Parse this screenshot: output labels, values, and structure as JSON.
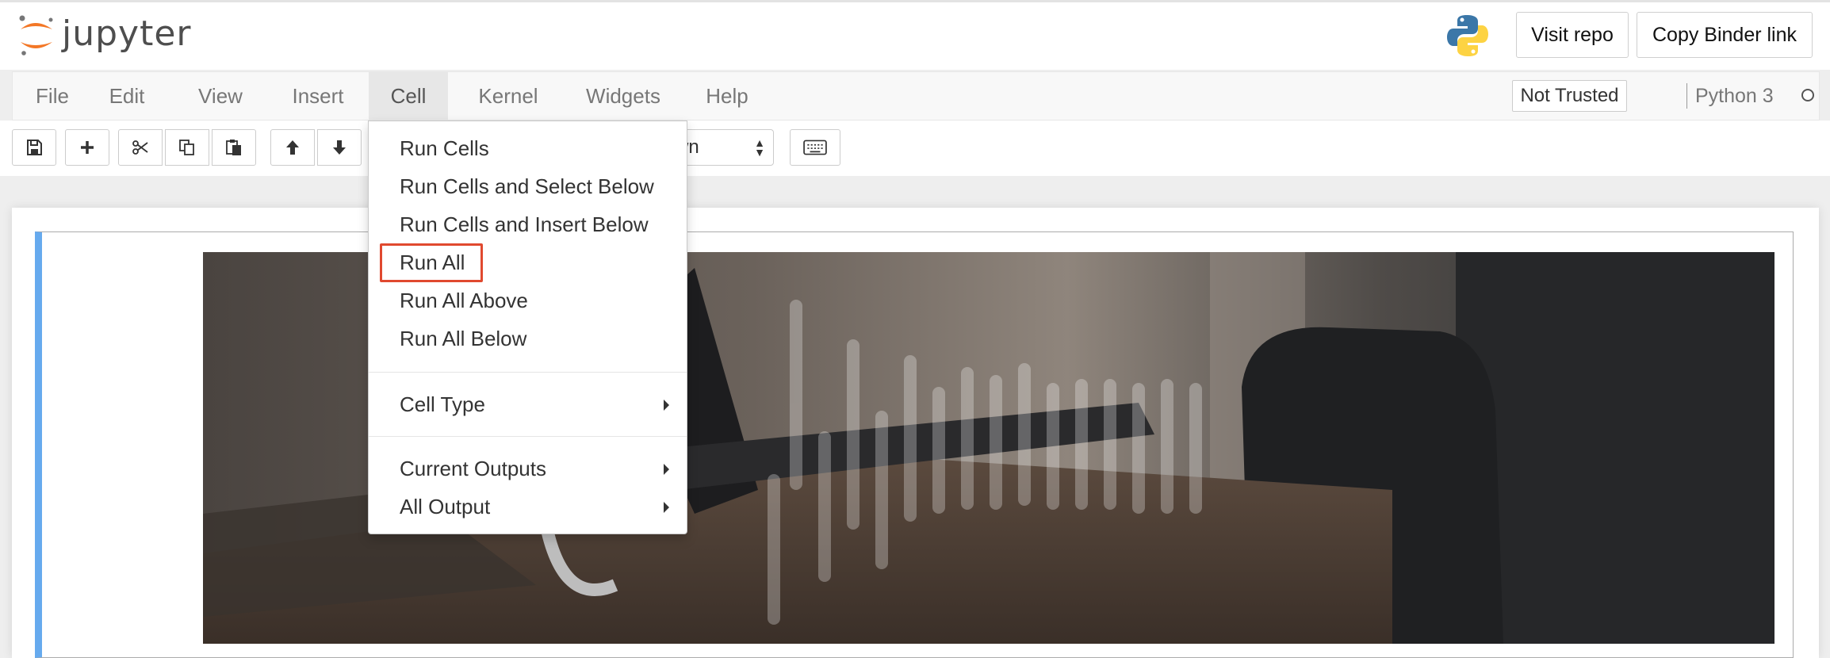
{
  "header": {
    "logo_text": "jupyter",
    "visit_repo_label": "Visit repo",
    "copy_binder_label": "Copy Binder link"
  },
  "menubar": {
    "items": [
      "File",
      "Edit",
      "View",
      "Insert",
      "Cell",
      "Kernel",
      "Widgets",
      "Help"
    ],
    "active_item": "Cell",
    "trust_status": "Not Trusted",
    "kernel_name": "Python 3"
  },
  "toolbar": {
    "buttons": [
      "save-icon",
      "plus-icon",
      "cut-icon",
      "copy-icon",
      "paste-icon",
      "arrow-up-icon",
      "arrow-down-icon",
      "keyboard-icon"
    ],
    "cell_type_value": "wn"
  },
  "cell_menu": {
    "items": [
      {
        "label": "Run Cells"
      },
      {
        "label": "Run Cells and Select Below"
      },
      {
        "label": "Run Cells and Insert Below"
      },
      {
        "label": "Run All",
        "highlighted": true
      },
      {
        "label": "Run All Above"
      },
      {
        "label": "Run All Below"
      },
      {
        "label": "Cell Type",
        "submenu": true
      },
      {
        "label": "Current Outputs",
        "submenu": true
      },
      {
        "label": "All Output",
        "submenu": true
      }
    ]
  },
  "colors": {
    "highlight_border": "#e0492f",
    "cell_selected_bar": "#66aaee",
    "jupyter_orange": "#f37726"
  }
}
